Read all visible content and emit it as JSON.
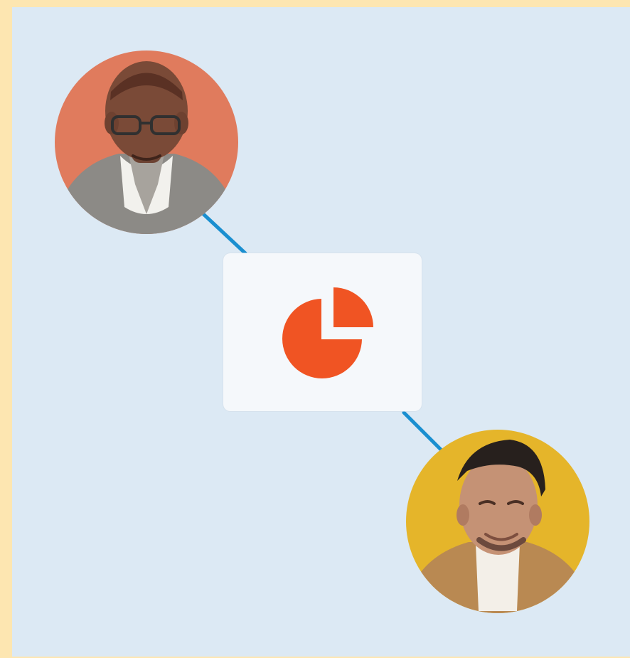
{
  "colors": {
    "page_background": "#fde6b1",
    "panel_background": "#dce9f4",
    "card_background": "#f5f8fb",
    "connector": "#1a8fd0",
    "chart_accent": "#f05423",
    "avatar_top_background": "#e07b5d",
    "avatar_bottom_background": "#e5b52a"
  },
  "card": {
    "icon": "pie-chart-icon"
  },
  "avatars": {
    "top": "person-avatar",
    "bottom": "person-avatar"
  }
}
